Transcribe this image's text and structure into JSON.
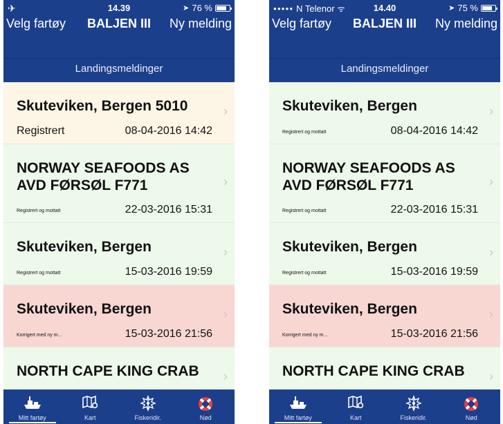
{
  "colors": {
    "header": "#1c3f8c",
    "registered": "#fdf5e6",
    "confirmed": "#edf9ea",
    "corrected": "#f8d7d3",
    "tabbar": "#1c3f8c"
  },
  "phones": [
    {
      "status": {
        "left_icon": "airplane-icon",
        "carrier": "",
        "time": "14.39",
        "battery": "76 %",
        "battery_level": 0.76
      },
      "nav": {
        "left": "Velg fartøy",
        "title": "BALJEN III",
        "right": "Ny melding"
      },
      "subheader": "Landingsmeldinger",
      "rows": [
        {
          "title": "Skuteviken, Bergen 5010",
          "status": "Registrert",
          "date": "08-04-2016 14:42",
          "state": "registered"
        },
        {
          "title": "NORWAY SEAFOODS AS AVD FØRSØL F771",
          "status": "Registrert og mottatt",
          "date": "22-03-2016 15:31",
          "state": "confirmed"
        },
        {
          "title": "Skuteviken, Bergen",
          "status": "Registrert og mottatt",
          "date": "15-03-2016 19:59",
          "state": "confirmed"
        },
        {
          "title": "Skuteviken, Bergen",
          "status": "Korrigert med ny m...",
          "date": "15-03-2016 21:56",
          "state": "corrected"
        },
        {
          "title": "NORTH CAPE KING CRAB",
          "status": "",
          "date": "",
          "state": "confirmed"
        }
      ],
      "tabs": [
        {
          "label": "Mitt fartøy",
          "icon": "boat-icon"
        },
        {
          "label": "Kart",
          "icon": "map-icon"
        },
        {
          "label": "Fiskeridir.",
          "icon": "emblem-icon"
        },
        {
          "label": "Nød",
          "icon": "lifebuoy-icon"
        }
      ]
    },
    {
      "status": {
        "left_icon": "signal-dots-icon",
        "carrier": "N Telenor",
        "time": "14.40",
        "battery": "75 %",
        "battery_level": 0.75
      },
      "nav": {
        "left": "Velg fartøy",
        "title": "BALJEN III",
        "right": "Ny melding"
      },
      "subheader": "Landingsmeldinger",
      "rows": [
        {
          "title": "Skuteviken, Bergen",
          "status": "Registrert og mottatt",
          "date": "08-04-2016 14:42",
          "state": "confirmed"
        },
        {
          "title": "NORWAY SEAFOODS AS AVD FØRSØL F771",
          "status": "Registrert og mottatt",
          "date": "22-03-2016 15:31",
          "state": "confirmed"
        },
        {
          "title": "Skuteviken, Bergen",
          "status": "Registrert og mottatt",
          "date": "15-03-2016 19:59",
          "state": "confirmed"
        },
        {
          "title": "Skuteviken, Bergen",
          "status": "Korrigert med ny m...",
          "date": "15-03-2016 21:56",
          "state": "corrected"
        },
        {
          "title": "NORTH CAPE KING CRAB",
          "status": "",
          "date": "",
          "state": "confirmed"
        }
      ],
      "tabs": [
        {
          "label": "Mitt fartøy",
          "icon": "boat-icon"
        },
        {
          "label": "Kart",
          "icon": "map-icon"
        },
        {
          "label": "Fiskeridir.",
          "icon": "emblem-icon"
        },
        {
          "label": "Nød",
          "icon": "lifebuoy-icon"
        }
      ]
    }
  ]
}
